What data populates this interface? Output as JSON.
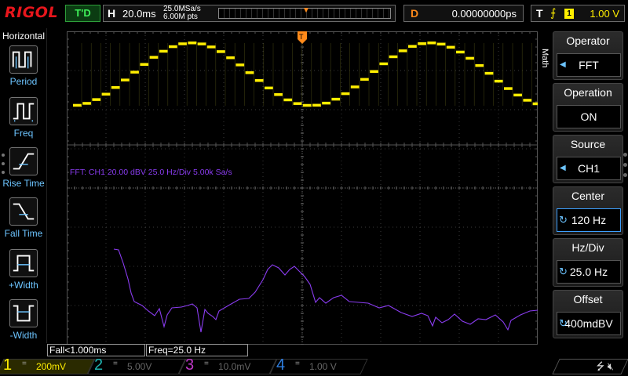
{
  "brand": "RIGOL",
  "status": {
    "run_state": "T'D"
  },
  "timebase": {
    "label": "H",
    "scale": "20.0ms",
    "sample_rate": "25.0MSa/s",
    "memory_depth": "6.00M pts",
    "trigger_marker": "T"
  },
  "delay": {
    "label": "D",
    "value": "0.00000000ps"
  },
  "trigger": {
    "label": "T",
    "edge_icon": "rising-edge-icon",
    "source": "1",
    "level": "1.00 V"
  },
  "left_panel": {
    "title": "Horizontal",
    "items": [
      {
        "label": "Period",
        "icon": "period-icon"
      },
      {
        "label": "Freq",
        "icon": "frequency-icon"
      },
      {
        "label": "Rise Time",
        "icon": "rise-time-icon"
      },
      {
        "label": "Fall Time",
        "icon": "fall-time-icon"
      },
      {
        "label": "+Width",
        "icon": "positive-width-icon"
      },
      {
        "label": "-Width",
        "icon": "negative-width-icon"
      }
    ]
  },
  "grid_markers": {
    "ch1": "1",
    "math": "M",
    "trigger_position": "T"
  },
  "fft_info": {
    "text": "FFT:  CH1  20.00 dBV   25.0 Hz/Div    5.00k Sa/s"
  },
  "right_menu": {
    "side_label": "Math",
    "items": [
      {
        "title": "Operator",
        "value": "FFT",
        "control": "arrow"
      },
      {
        "title": "Operation",
        "value": "ON",
        "control": "none"
      },
      {
        "title": "Source",
        "value": "CH1",
        "control": "arrow"
      },
      {
        "title": "Center",
        "value": "120 Hz",
        "control": "knob"
      },
      {
        "title": "Hz/Div",
        "value": "25.0 Hz",
        "control": "knob"
      },
      {
        "title": "Offset",
        "value": "400mdBV",
        "control": "knob"
      }
    ]
  },
  "readouts": {
    "fall": "Fall<1.000ms",
    "freq": "Freq=25.0 Hz"
  },
  "channels": [
    {
      "num": "1",
      "coupling": "=",
      "scale": "200mV",
      "color": "#ffee00"
    },
    {
      "num": "2",
      "coupling": "=",
      "scale": "5.00V",
      "color": "#1fb3b0"
    },
    {
      "num": "3",
      "coupling": "=",
      "scale": "10.0mV",
      "color": "#c038c8"
    },
    {
      "num": "4",
      "coupling": "=",
      "scale": "1.00 V",
      "color": "#2f7fe0"
    }
  ],
  "colors": {
    "ch1": "#ffee00",
    "math": "#8a3cf0",
    "accent": "#ff8a1a",
    "menu_highlight": "#3da0ff"
  },
  "system_icons": [
    "usb-icon",
    "sound-muted-icon"
  ]
}
